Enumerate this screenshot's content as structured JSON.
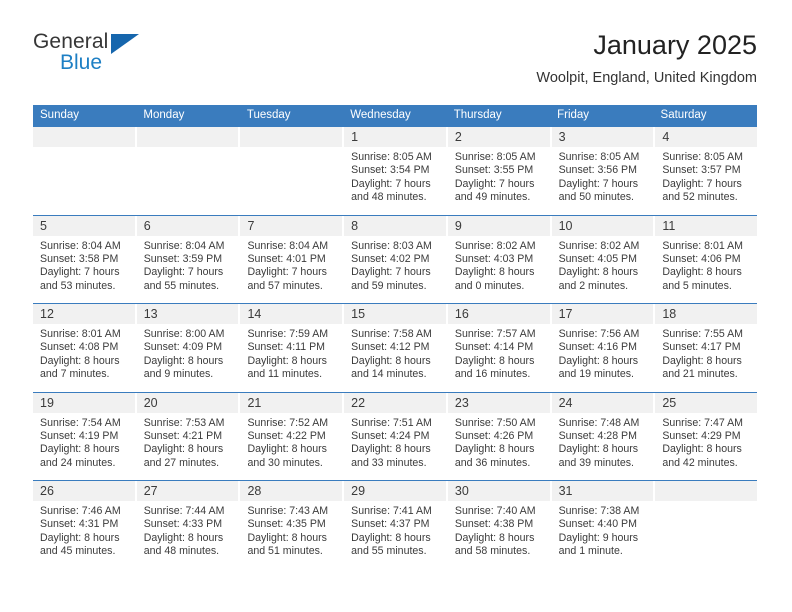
{
  "brand": {
    "name_top": "General",
    "name_bottom": "Blue",
    "color_top": "#363636",
    "color_bottom": "#1d7fc4",
    "triangle_color": "#1666ad"
  },
  "header": {
    "title": "January 2025",
    "subtitle": "Woolpit, England, United Kingdom"
  },
  "theme": {
    "header_bar": "#3a7cbe",
    "daynum_bg": "#f1f1f1",
    "text": "#3b3b3b"
  },
  "weekday_headers": [
    "Sunday",
    "Monday",
    "Tuesday",
    "Wednesday",
    "Thursday",
    "Friday",
    "Saturday"
  ],
  "weeks": [
    [
      {
        "day": "",
        "sunrise": "",
        "sunset": "",
        "daylight_line1": "",
        "daylight_line2": ""
      },
      {
        "day": "",
        "sunrise": "",
        "sunset": "",
        "daylight_line1": "",
        "daylight_line2": ""
      },
      {
        "day": "",
        "sunrise": "",
        "sunset": "",
        "daylight_line1": "",
        "daylight_line2": ""
      },
      {
        "day": "1",
        "sunrise": "Sunrise: 8:05 AM",
        "sunset": "Sunset: 3:54 PM",
        "daylight_line1": "Daylight: 7 hours",
        "daylight_line2": "and 48 minutes."
      },
      {
        "day": "2",
        "sunrise": "Sunrise: 8:05 AM",
        "sunset": "Sunset: 3:55 PM",
        "daylight_line1": "Daylight: 7 hours",
        "daylight_line2": "and 49 minutes."
      },
      {
        "day": "3",
        "sunrise": "Sunrise: 8:05 AM",
        "sunset": "Sunset: 3:56 PM",
        "daylight_line1": "Daylight: 7 hours",
        "daylight_line2": "and 50 minutes."
      },
      {
        "day": "4",
        "sunrise": "Sunrise: 8:05 AM",
        "sunset": "Sunset: 3:57 PM",
        "daylight_line1": "Daylight: 7 hours",
        "daylight_line2": "and 52 minutes."
      }
    ],
    [
      {
        "day": "5",
        "sunrise": "Sunrise: 8:04 AM",
        "sunset": "Sunset: 3:58 PM",
        "daylight_line1": "Daylight: 7 hours",
        "daylight_line2": "and 53 minutes."
      },
      {
        "day": "6",
        "sunrise": "Sunrise: 8:04 AM",
        "sunset": "Sunset: 3:59 PM",
        "daylight_line1": "Daylight: 7 hours",
        "daylight_line2": "and 55 minutes."
      },
      {
        "day": "7",
        "sunrise": "Sunrise: 8:04 AM",
        "sunset": "Sunset: 4:01 PM",
        "daylight_line1": "Daylight: 7 hours",
        "daylight_line2": "and 57 minutes."
      },
      {
        "day": "8",
        "sunrise": "Sunrise: 8:03 AM",
        "sunset": "Sunset: 4:02 PM",
        "daylight_line1": "Daylight: 7 hours",
        "daylight_line2": "and 59 minutes."
      },
      {
        "day": "9",
        "sunrise": "Sunrise: 8:02 AM",
        "sunset": "Sunset: 4:03 PM",
        "daylight_line1": "Daylight: 8 hours",
        "daylight_line2": "and 0 minutes."
      },
      {
        "day": "10",
        "sunrise": "Sunrise: 8:02 AM",
        "sunset": "Sunset: 4:05 PM",
        "daylight_line1": "Daylight: 8 hours",
        "daylight_line2": "and 2 minutes."
      },
      {
        "day": "11",
        "sunrise": "Sunrise: 8:01 AM",
        "sunset": "Sunset: 4:06 PM",
        "daylight_line1": "Daylight: 8 hours",
        "daylight_line2": "and 5 minutes."
      }
    ],
    [
      {
        "day": "12",
        "sunrise": "Sunrise: 8:01 AM",
        "sunset": "Sunset: 4:08 PM",
        "daylight_line1": "Daylight: 8 hours",
        "daylight_line2": "and 7 minutes."
      },
      {
        "day": "13",
        "sunrise": "Sunrise: 8:00 AM",
        "sunset": "Sunset: 4:09 PM",
        "daylight_line1": "Daylight: 8 hours",
        "daylight_line2": "and 9 minutes."
      },
      {
        "day": "14",
        "sunrise": "Sunrise: 7:59 AM",
        "sunset": "Sunset: 4:11 PM",
        "daylight_line1": "Daylight: 8 hours",
        "daylight_line2": "and 11 minutes."
      },
      {
        "day": "15",
        "sunrise": "Sunrise: 7:58 AM",
        "sunset": "Sunset: 4:12 PM",
        "daylight_line1": "Daylight: 8 hours",
        "daylight_line2": "and 14 minutes."
      },
      {
        "day": "16",
        "sunrise": "Sunrise: 7:57 AM",
        "sunset": "Sunset: 4:14 PM",
        "daylight_line1": "Daylight: 8 hours",
        "daylight_line2": "and 16 minutes."
      },
      {
        "day": "17",
        "sunrise": "Sunrise: 7:56 AM",
        "sunset": "Sunset: 4:16 PM",
        "daylight_line1": "Daylight: 8 hours",
        "daylight_line2": "and 19 minutes."
      },
      {
        "day": "18",
        "sunrise": "Sunrise: 7:55 AM",
        "sunset": "Sunset: 4:17 PM",
        "daylight_line1": "Daylight: 8 hours",
        "daylight_line2": "and 21 minutes."
      }
    ],
    [
      {
        "day": "19",
        "sunrise": "Sunrise: 7:54 AM",
        "sunset": "Sunset: 4:19 PM",
        "daylight_line1": "Daylight: 8 hours",
        "daylight_line2": "and 24 minutes."
      },
      {
        "day": "20",
        "sunrise": "Sunrise: 7:53 AM",
        "sunset": "Sunset: 4:21 PM",
        "daylight_line1": "Daylight: 8 hours",
        "daylight_line2": "and 27 minutes."
      },
      {
        "day": "21",
        "sunrise": "Sunrise: 7:52 AM",
        "sunset": "Sunset: 4:22 PM",
        "daylight_line1": "Daylight: 8 hours",
        "daylight_line2": "and 30 minutes."
      },
      {
        "day": "22",
        "sunrise": "Sunrise: 7:51 AM",
        "sunset": "Sunset: 4:24 PM",
        "daylight_line1": "Daylight: 8 hours",
        "daylight_line2": "and 33 minutes."
      },
      {
        "day": "23",
        "sunrise": "Sunrise: 7:50 AM",
        "sunset": "Sunset: 4:26 PM",
        "daylight_line1": "Daylight: 8 hours",
        "daylight_line2": "and 36 minutes."
      },
      {
        "day": "24",
        "sunrise": "Sunrise: 7:48 AM",
        "sunset": "Sunset: 4:28 PM",
        "daylight_line1": "Daylight: 8 hours",
        "daylight_line2": "and 39 minutes."
      },
      {
        "day": "25",
        "sunrise": "Sunrise: 7:47 AM",
        "sunset": "Sunset: 4:29 PM",
        "daylight_line1": "Daylight: 8 hours",
        "daylight_line2": "and 42 minutes."
      }
    ],
    [
      {
        "day": "26",
        "sunrise": "Sunrise: 7:46 AM",
        "sunset": "Sunset: 4:31 PM",
        "daylight_line1": "Daylight: 8 hours",
        "daylight_line2": "and 45 minutes."
      },
      {
        "day": "27",
        "sunrise": "Sunrise: 7:44 AM",
        "sunset": "Sunset: 4:33 PM",
        "daylight_line1": "Daylight: 8 hours",
        "daylight_line2": "and 48 minutes."
      },
      {
        "day": "28",
        "sunrise": "Sunrise: 7:43 AM",
        "sunset": "Sunset: 4:35 PM",
        "daylight_line1": "Daylight: 8 hours",
        "daylight_line2": "and 51 minutes."
      },
      {
        "day": "29",
        "sunrise": "Sunrise: 7:41 AM",
        "sunset": "Sunset: 4:37 PM",
        "daylight_line1": "Daylight: 8 hours",
        "daylight_line2": "and 55 minutes."
      },
      {
        "day": "30",
        "sunrise": "Sunrise: 7:40 AM",
        "sunset": "Sunset: 4:38 PM",
        "daylight_line1": "Daylight: 8 hours",
        "daylight_line2": "and 58 minutes."
      },
      {
        "day": "31",
        "sunrise": "Sunrise: 7:38 AM",
        "sunset": "Sunset: 4:40 PM",
        "daylight_line1": "Daylight: 9 hours",
        "daylight_line2": "and 1 minute."
      },
      {
        "day": "",
        "sunrise": "",
        "sunset": "",
        "daylight_line1": "",
        "daylight_line2": ""
      }
    ]
  ]
}
